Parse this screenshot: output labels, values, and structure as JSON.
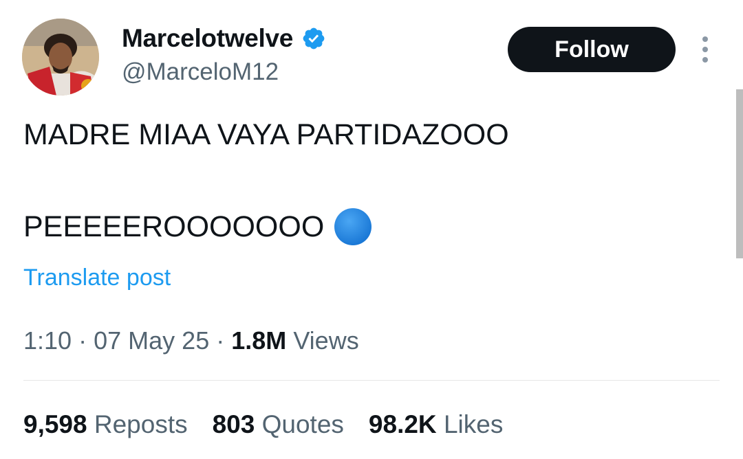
{
  "author": {
    "display_name": "Marcelotwelve",
    "handle": "@MarceloM12",
    "verified_icon": "verified-badge-icon",
    "verified_color": "#1d9bf0"
  },
  "follow_button": {
    "label": "Follow"
  },
  "more_menu": {
    "icon": "more-vertical-icon"
  },
  "tweet": {
    "line1": "MADRE MIAA VAYA PARTIDAZOOO",
    "line2": "PEEEEEROOOOOOO",
    "emoji_icon": "blue-circle-icon",
    "emoji_color": "#1d87e6"
  },
  "translate": {
    "label": "Translate post",
    "color": "#1d9bf0"
  },
  "meta": {
    "time": "1:10",
    "separator": "·",
    "date": "07 May 25",
    "views_count": "1.8M",
    "views_label": "Views"
  },
  "stats": {
    "reposts_count": "9,598",
    "reposts_label": "Reposts",
    "quotes_count": "803",
    "quotes_label": "Quotes",
    "likes_count": "98.2K",
    "likes_label": "Likes"
  }
}
